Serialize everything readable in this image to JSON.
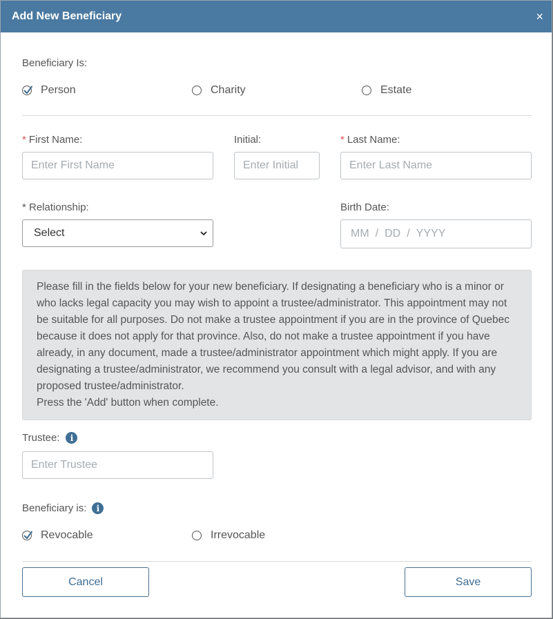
{
  "dialog": {
    "title": "Add New Beneficiary",
    "close_icon": "×"
  },
  "beneficiary_type": {
    "label": "Beneficiary Is:",
    "options": [
      {
        "label": "Person",
        "selected": true
      },
      {
        "label": "Charity",
        "selected": false
      },
      {
        "label": "Estate",
        "selected": false
      }
    ]
  },
  "fields": {
    "required_mark": "*",
    "first_name": {
      "label": "First Name:",
      "placeholder": "Enter First Name",
      "value": ""
    },
    "initial": {
      "label": "Initial:",
      "placeholder": "Enter Initial",
      "value": ""
    },
    "last_name": {
      "label": "Last Name:",
      "placeholder": "Enter Last Name",
      "value": ""
    },
    "relationship": {
      "label": "* Relationship:",
      "selected": "Select"
    },
    "birth_date": {
      "label": "Birth Date:",
      "mm": "MM",
      "dd": "DD",
      "yyyy": "YYYY",
      "sep": "/"
    },
    "trustee": {
      "label": "Trustee:",
      "placeholder": "Enter Trustee",
      "value": ""
    }
  },
  "notice": {
    "paragraph": "Please fill in the fields below for your new beneficiary. If designating a beneficiary who is a minor or who lacks legal capacity you may wish to appoint a trustee/administrator. This appointment may not be suitable for all purposes. Do not make a trustee appointment if you are in the province of Quebec because it does not apply for that province. Also, do not make a trustee appointment if you have already, in any document, made a trustee/administrator appointment which might apply. If you are designating a trustee/administrator, we recommend you consult with a legal advisor, and with any proposed trustee/administrator.",
    "instruction": "Press the 'Add' button when complete."
  },
  "revocability": {
    "label": "Beneficiary is:",
    "options": [
      {
        "label": "Revocable",
        "selected": true
      },
      {
        "label": "Irrevocable",
        "selected": false
      }
    ]
  },
  "info_icon": "i",
  "buttons": {
    "cancel": "Cancel",
    "save": "Save"
  },
  "colors": {
    "header": "#4a79a1",
    "accent": "#3e6d93",
    "required": "#d9534f"
  }
}
